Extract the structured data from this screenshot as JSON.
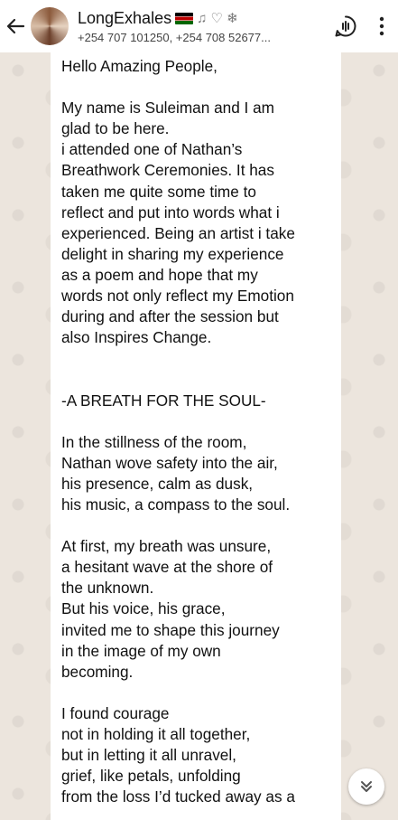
{
  "header": {
    "contact_name": "LongExhales",
    "name_emoji": "♫ ♡ ❄",
    "subtitle": "+254 707 101250, +254 708 52677..."
  },
  "message": {
    "lines": [
      "Hello Amazing People,",
      "",
      "My name is Suleiman and I am",
      "glad to be here.",
      "i attended one of Nathan’s",
      "Breathwork Ceremonies. It has",
      "taken me quite some time to",
      "reflect and put into words what i",
      "experienced. Being an artist i take",
      "delight in sharing my experience",
      "as a poem and hope that my",
      "words not only reflect my Emotion",
      "during and after the session but",
      "also Inspires Change.",
      "",
      "",
      "-A BREATH FOR THE SOUL-",
      "",
      "In the stillness of the room,",
      "Nathan wove safety into the air,",
      "his presence, calm as dusk,",
      "his music, a compass to the soul.",
      "",
      "At first, my breath was unsure,",
      "a hesitant wave at the shore of",
      "the unknown.",
      "But his voice, his grace,",
      "invited me to shape this journey",
      "in the image of my own",
      "becoming.",
      "",
      "I found courage",
      "not in holding it all together,",
      "but in letting it all unravel,",
      "grief, like petals, unfolding",
      "from the loss I’d tucked away as a"
    ]
  }
}
